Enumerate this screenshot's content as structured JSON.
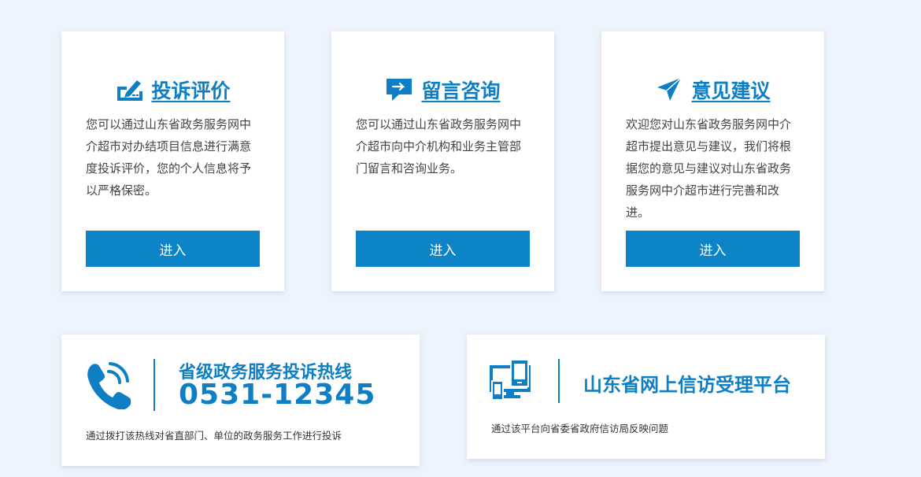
{
  "cards": [
    {
      "title": "投诉评价",
      "icon": "complaint-edit-icon",
      "description": "您可以通过山东省政务服务网中介超市对办结项目信息进行满意度投诉评价，您的个人信息将予以严格保密。",
      "button_label": "进入"
    },
    {
      "title": "留言咨询",
      "icon": "message-chat-icon",
      "description": "您可以通过山东省政务服务网中介超市向中介机构和业务主管部门留言和咨询业务。",
      "button_label": "进入"
    },
    {
      "title": "意见建议",
      "icon": "paper-plane-icon",
      "description": "欢迎您对山东省政务服务网中介超市提出意见与建议，我们将根据您的意见与建议对山东省政务服务网中介超市进行完善和改进。",
      "button_label": "进入"
    }
  ],
  "hotline": {
    "title": "省级政务服务投诉热线",
    "number": "0531-12345",
    "description": "通过拨打该热线对省直部门、单位的政务服务工作进行投诉",
    "icon": "phone-icon"
  },
  "petition": {
    "title": "山东省网上信访受理平台",
    "description": "通过该平台向省委省政府信访局反映问题",
    "icon": "computer-devices-icon"
  },
  "colors": {
    "accent": "#0e7ec5",
    "button": "#0e84c8",
    "background": "#eef4fd"
  }
}
